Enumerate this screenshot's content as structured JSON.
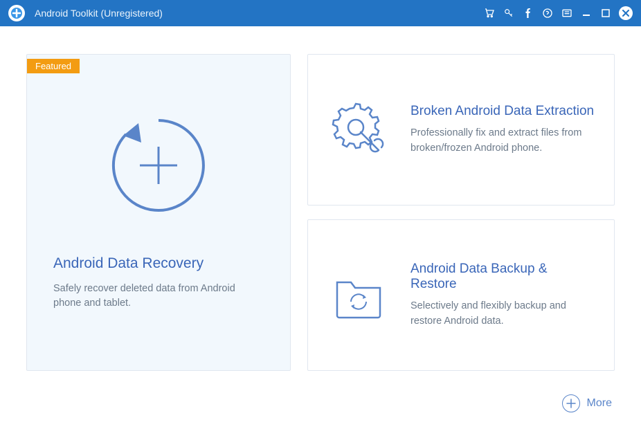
{
  "titlebar": {
    "title": "Android Toolkit (Unregistered)"
  },
  "cards": {
    "featured_label": "Featured",
    "recovery": {
      "title": "Android Data Recovery",
      "desc": "Safely recover deleted data from Android phone and tablet."
    },
    "extraction": {
      "title": "Broken Android Data Extraction",
      "desc": "Professionally fix and extract files from broken/frozen Android phone."
    },
    "backup": {
      "title": "Android Data Backup & Restore",
      "desc": "Selectively and flexibly backup and restore Android data."
    }
  },
  "more_label": "More"
}
